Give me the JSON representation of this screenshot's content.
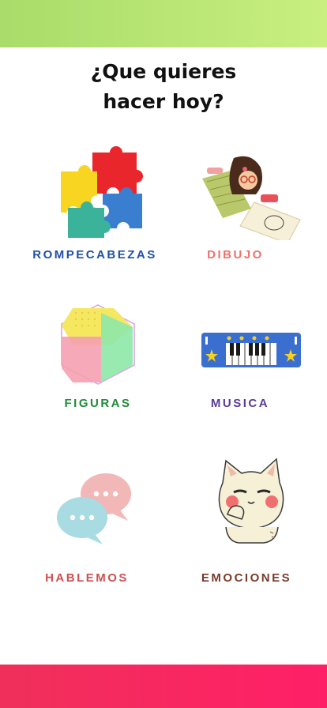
{
  "header": {
    "title_line1": "¿Que quieres",
    "title_line2": "hacer hoy?"
  },
  "options": [
    {
      "label": "ROMPECABEZAS",
      "color": "#1f4fa8",
      "icon": "puzzle-icon"
    },
    {
      "label": "DIBUJO",
      "color": "#f0706c",
      "icon": "drawing-girl-icon"
    },
    {
      "label": "FIGURAS",
      "color": "#1f8a3a",
      "icon": "hexagon-shapes-icon"
    },
    {
      "label": "MUSICA",
      "color": "#5a3a9a",
      "icon": "piano-keyboard-icon"
    },
    {
      "label": "HABLEMOS",
      "color": "#d05050",
      "icon": "chat-bubbles-icon"
    },
    {
      "label": "EMOCIONES",
      "color": "#7a3a2a",
      "icon": "cat-emotion-icon"
    }
  ],
  "colors": {
    "top_bar": "#b8e576",
    "bottom_bar": "#f92a60"
  }
}
